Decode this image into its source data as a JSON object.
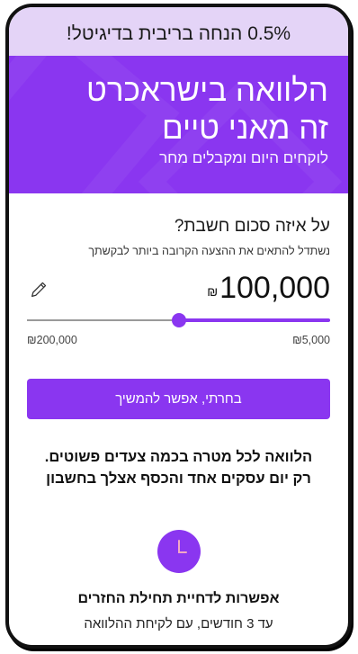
{
  "promo_bar": {
    "text": "0.5% הנחה בריבית בדיגיטל!"
  },
  "hero": {
    "title_line1": "הלוואה בישראכרט",
    "title_line2": "זה מאני טיים",
    "subtitle": "לוקחים היום ומקבלים מחר"
  },
  "loan": {
    "question": "על איזה סכום חשבת?",
    "hint": "נשתדל להתאים את ההצעה הקרובה ביותר לבקשתך",
    "amount": "100,000",
    "currency": "₪",
    "slider_value_fraction": 0.5,
    "min_label": "₪5,000",
    "max_label": "₪200,000",
    "cta_label": "בחרתי, אפשר להמשיך"
  },
  "promo_text": "הלוואה לכל מטרה בכמה צעדים פשוטים. רק יום עסקים אחד והכסף אצלך בחשבון",
  "feature": {
    "icon": "clock-icon",
    "title": "אפשרות לדחיית תחילת החזרים",
    "subtitle": "עד 3 חודשים, עם לקיחת ההלוואה"
  },
  "colors": {
    "brand": "#8a36f0",
    "promo_bg": "#e4d4f7"
  }
}
